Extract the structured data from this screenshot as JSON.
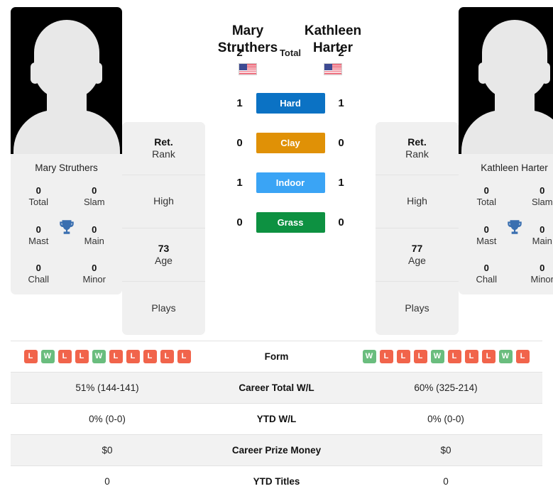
{
  "colors": {
    "hard": "#0b72c4",
    "clay": "#e09106",
    "indoor": "#3aa4f5",
    "grass": "#0d9141",
    "win": "#6abd7e",
    "loss": "#f1644b",
    "trophy": "#3a6fb0",
    "card_bg": "#f0f0f0",
    "row_stripe": "#f2f2f2"
  },
  "players": {
    "left": {
      "name_line1": "Mary",
      "name_line2": "Struthers",
      "full_name": "Mary Struthers",
      "flag": "us-flag-icon",
      "titles": [
        {
          "value": "0",
          "label": "Total"
        },
        {
          "value": "0",
          "label": "Slam"
        },
        {
          "value": "0",
          "label": "Mast"
        },
        {
          "value": "0",
          "label": "Main"
        },
        {
          "value": "0",
          "label": "Chall"
        },
        {
          "value": "0",
          "label": "Minor"
        }
      ],
      "info": [
        {
          "value": "Ret.",
          "label": "Rank"
        },
        {
          "value": "",
          "label": "High"
        },
        {
          "value": "73",
          "label": "Age"
        },
        {
          "value": "",
          "label": "Plays"
        }
      ]
    },
    "right": {
      "name_line1": "Kathleen",
      "name_line2": "Harter",
      "full_name": "Kathleen Harter",
      "flag": "us-flag-icon",
      "titles": [
        {
          "value": "0",
          "label": "Total"
        },
        {
          "value": "0",
          "label": "Slam"
        },
        {
          "value": "0",
          "label": "Mast"
        },
        {
          "value": "0",
          "label": "Main"
        },
        {
          "value": "0",
          "label": "Chall"
        },
        {
          "value": "0",
          "label": "Minor"
        }
      ],
      "info": [
        {
          "value": "Ret.",
          "label": "Rank"
        },
        {
          "value": "",
          "label": "High"
        },
        {
          "value": "77",
          "label": "Age"
        },
        {
          "value": "",
          "label": "Plays"
        }
      ]
    }
  },
  "h2h": [
    {
      "surface": "Total",
      "left": "2",
      "right": "2",
      "styled": false,
      "color": ""
    },
    {
      "surface": "Hard",
      "left": "1",
      "right": "1",
      "styled": true,
      "color": "#0b72c4"
    },
    {
      "surface": "Clay",
      "left": "0",
      "right": "0",
      "styled": true,
      "color": "#e09106"
    },
    {
      "surface": "Indoor",
      "left": "1",
      "right": "1",
      "styled": true,
      "color": "#3aa4f5"
    },
    {
      "surface": "Grass",
      "left": "0",
      "right": "0",
      "styled": true,
      "color": "#0d9141"
    }
  ],
  "form": {
    "label": "Form",
    "left": [
      "L",
      "W",
      "L",
      "L",
      "W",
      "L",
      "L",
      "L",
      "L",
      "L"
    ],
    "right": [
      "W",
      "L",
      "L",
      "L",
      "W",
      "L",
      "L",
      "L",
      "W",
      "L"
    ]
  },
  "table_rows": [
    {
      "label": "Career Total W/L",
      "left": "51% (144-141)",
      "right": "60% (325-214)"
    },
    {
      "label": "YTD W/L",
      "left": "0% (0-0)",
      "right": "0% (0-0)"
    },
    {
      "label": "Career Prize Money",
      "left": "$0",
      "right": "$0"
    },
    {
      "label": "YTD Titles",
      "left": "0",
      "right": "0"
    }
  ]
}
